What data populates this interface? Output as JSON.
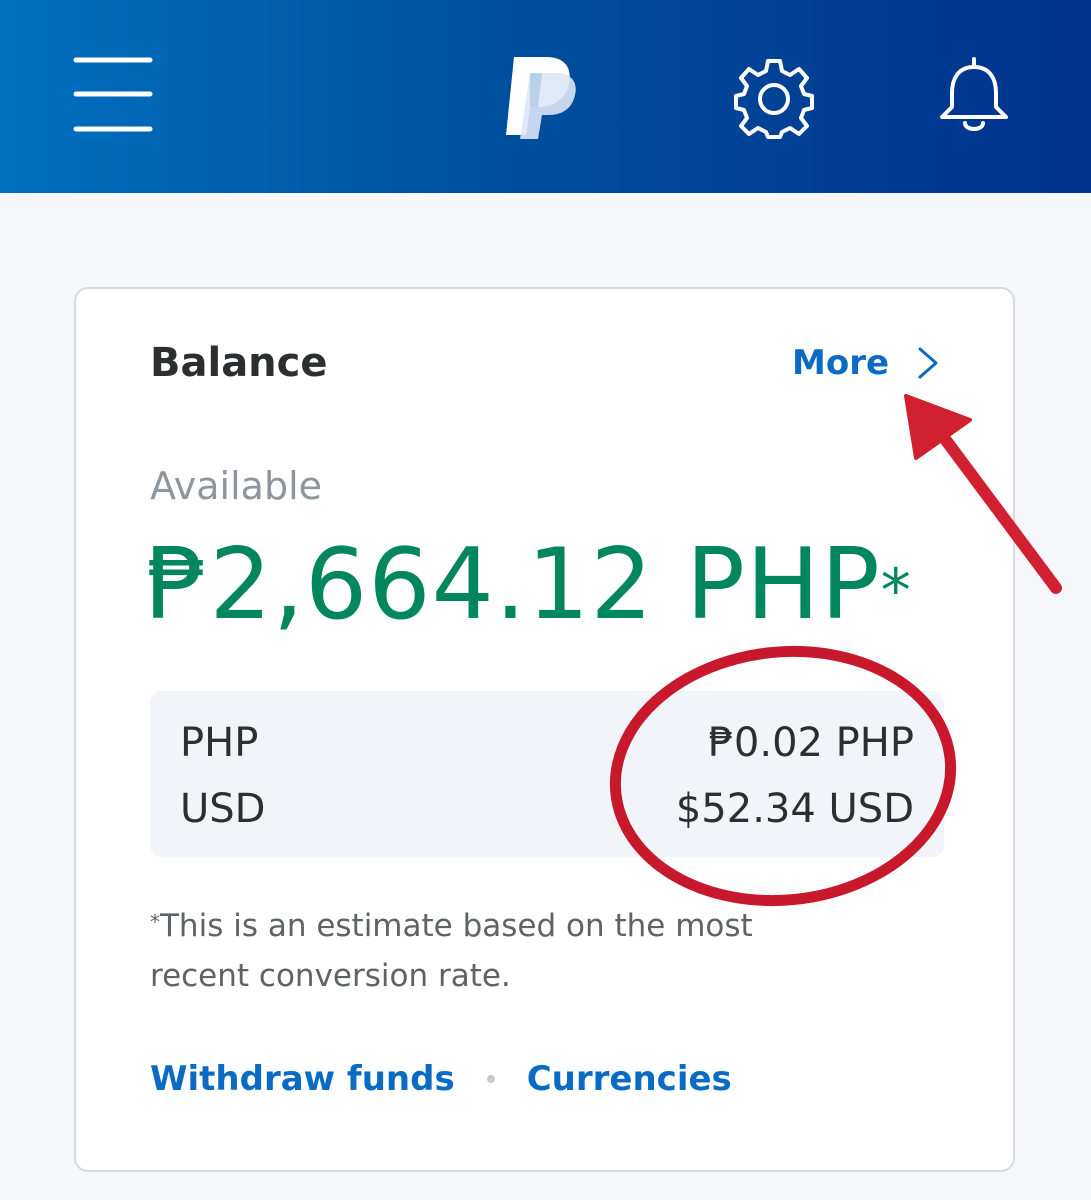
{
  "header": {
    "menu_icon": "hamburger-menu-icon",
    "logo_icon": "paypal-logo",
    "settings_icon": "gear-icon",
    "notifications_icon": "bell-icon",
    "background_gradient": [
      "#0070c0",
      "#00318d"
    ]
  },
  "balance": {
    "title": "Balance",
    "more_label": "More",
    "more_icon": "chevron-right-icon",
    "available_label": "Available",
    "total_amount": "₱2,664.12 PHP",
    "total_marker": "*",
    "currencies": [
      {
        "code": "PHP",
        "amount": "₱0.02 PHP"
      },
      {
        "code": "USD",
        "amount": "$52.34 USD"
      }
    ],
    "footnote_marker": "*",
    "footnote": "This is an estimate based on the most recent conversion rate.",
    "withdraw_label": "Withdraw funds",
    "currencies_label": "Currencies"
  },
  "annotations": {
    "arrow_color": "#d1202f",
    "circle_color": "#c8192c"
  },
  "colors": {
    "link": "#0a6bc4",
    "amount_green": "#01865e",
    "page_background": "#f5f7fa"
  }
}
